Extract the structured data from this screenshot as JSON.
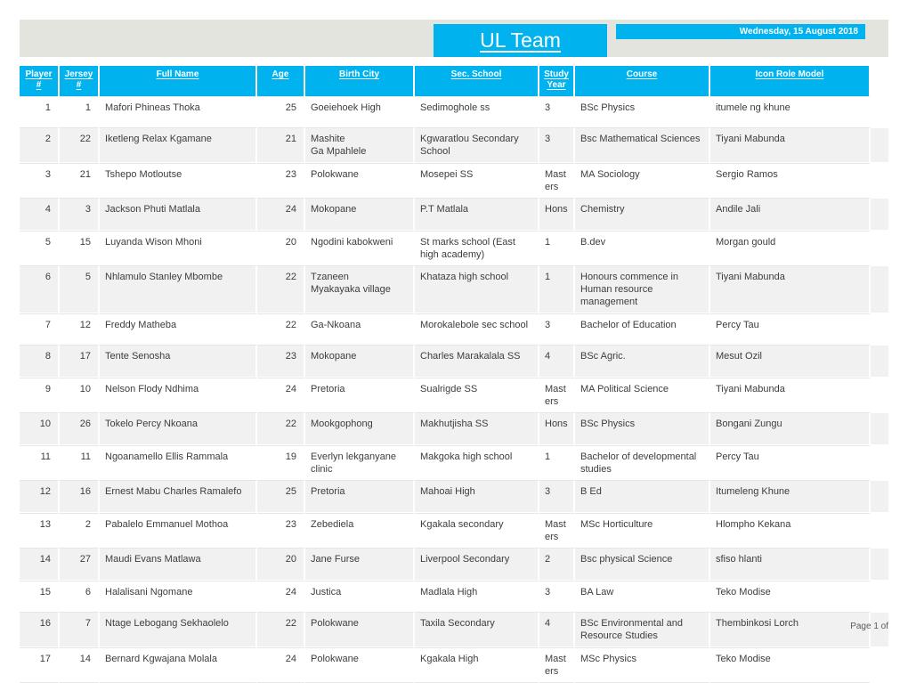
{
  "header": {
    "title": "UL Team",
    "date": "Wednesday, 15 August 2018",
    "band_color": "#e3e4de",
    "accent_color": "#00b3ee"
  },
  "table": {
    "columns": [
      {
        "key": "player",
        "label_line1": "Player",
        "label_line2": "#",
        "align": "num"
      },
      {
        "key": "jersey",
        "label_line1": "Jersey",
        "label_line2": "#",
        "align": "num"
      },
      {
        "key": "name",
        "label_line1": "Full Name",
        "label_line2": "",
        "align": "txt"
      },
      {
        "key": "age",
        "label_line1": "Age",
        "label_line2": "",
        "align": "num"
      },
      {
        "key": "city",
        "label_line1": "Birth City",
        "label_line2": "",
        "align": "txt"
      },
      {
        "key": "school",
        "label_line1": "Sec. School",
        "label_line2": "",
        "align": "txt"
      },
      {
        "key": "year",
        "label_line1": "Study",
        "label_line2": "Year",
        "align": "txt"
      },
      {
        "key": "course",
        "label_line1": "Course",
        "label_line2": "",
        "align": "txt"
      },
      {
        "key": "icon",
        "label_line1": "Icon Role Model",
        "label_line2": "",
        "align": "txt"
      }
    ],
    "rows": [
      {
        "player": "1",
        "jersey": "1",
        "name": "Mafori Phineas Thoka",
        "age": "25",
        "city": "Goeiehoek High",
        "school": "Sedimoghole ss",
        "year": "3",
        "course": "BSc Physics",
        "icon": "itumele ng khune"
      },
      {
        "player": "2",
        "jersey": "22",
        "name": "Iketleng Relax Kgamane",
        "age": "21",
        "city": "Mashite\n Ga Mpahlele",
        "school": "Kgwaratlou Secondary School",
        "year": "3",
        "course": "Bsc Mathematical Sciences",
        "icon": "Tiyani Mabunda"
      },
      {
        "player": "3",
        "jersey": "21",
        "name": "Tshepo Motloutse",
        "age": "23",
        "city": "Polokwane",
        "school": "Mosepei SS",
        "year": "Masters",
        "course": "MA Sociology",
        "icon": "Sergio Ramos"
      },
      {
        "player": "4",
        "jersey": "3",
        "name": "Jackson Phuti Matlala",
        "age": "24",
        "city": "Mokopane",
        "school": "P.T Matlala",
        "year": "Hons",
        "course": "Chemistry",
        "icon": "Andile Jali"
      },
      {
        "player": "5",
        "jersey": "15",
        "name": "Luyanda Wison Mhoni",
        "age": "20",
        "city": "Ngodini kabokweni",
        "school": "St marks school (East high academy)",
        "year": "1",
        "course": "B.dev",
        "icon": "Morgan gould"
      },
      {
        "player": "6",
        "jersey": "5",
        "name": "Nhlamulo Stanley  Mbombe",
        "age": "22",
        "city": "Tzaneen\n Myakayaka village",
        "school": "Khataza high school",
        "year": "1",
        "course": "Honours commence in Human resource management",
        "icon": "Tiyani Mabunda"
      },
      {
        "player": "7",
        "jersey": "12",
        "name": "Freddy  Matheba",
        "age": "22",
        "city": "Ga-Nkoana",
        "school": "Morokalebole sec school",
        "year": "3",
        "course": "Bachelor of Education",
        "icon": "Percy Tau"
      },
      {
        "player": "8",
        "jersey": "17",
        "name": "Tente Senosha",
        "age": "23",
        "city": "Mokopane",
        "school": "Charles Marakalala SS",
        "year": "4",
        "course": "BSc Agric.",
        "icon": "Mesut Ozil"
      },
      {
        "player": "9",
        "jersey": "10",
        "name": "Nelson Flody Ndhima",
        "age": "24",
        "city": "Pretoria",
        "school": "Sualrigde SS",
        "year": "Masters",
        "course": "MA Political Science",
        "icon": "Tiyani Mabunda"
      },
      {
        "player": "10",
        "jersey": "26",
        "name": "Tokelo Percy Nkoana",
        "age": "22",
        "city": "Mookgophong",
        "school": "Makhutjisha SS",
        "year": "Hons",
        "course": "BSc Physics",
        "icon": "Bongani Zungu"
      },
      {
        "player": "11",
        "jersey": "11",
        "name": "Ngoanamello Ellis Rammala",
        "age": "19",
        "city": "Everlyn lekganyane clinic",
        "school": "Makgoka high school",
        "year": "1",
        "course": "Bachelor of developmental studies",
        "icon": "Percy Tau"
      },
      {
        "player": "12",
        "jersey": "16",
        "name": "Ernest Mabu Charles Ramalefo",
        "age": "25",
        "city": "Pretoria",
        "school": "Mahoai High",
        "year": "3",
        "course": "B Ed",
        "icon": "Itumeleng Khune"
      },
      {
        "player": "13",
        "jersey": "2",
        "name": "Pabalelo Emmanuel Mothoa",
        "age": "23",
        "city": "Zebediela",
        "school": "Kgakala secondary",
        "year": "Masters",
        "course": "MSc Horticulture",
        "icon": "Hlompho Kekana"
      },
      {
        "player": "14",
        "jersey": "27",
        "name": "Maudi Evans Matlawa",
        "age": "20",
        "city": "Jane Furse",
        "school": "Liverpool Secondary",
        "year": "2",
        "course": "Bsc physical Science",
        "icon": "sfiso hlanti"
      },
      {
        "player": "15",
        "jersey": "6",
        "name": "Halalisani Ngomane",
        "age": "24",
        "city": "Justica",
        "school": "Madlala High",
        "year": "3",
        "course": "BA Law",
        "icon": "Teko Modise"
      },
      {
        "player": "16",
        "jersey": "7",
        "name": "Ntage Lebogang Sekhaolelo",
        "age": "22",
        "city": "Polokwane",
        "school": "Taxila Secondary",
        "year": "4",
        "course": "BSc Environmental and Resource Studies",
        "icon": "Thembinkosi Lorch"
      },
      {
        "player": "17",
        "jersey": "14",
        "name": "Bernard Kgwajana Molala",
        "age": "24",
        "city": "Polokwane",
        "school": "Kgakala High",
        "year": "Masters",
        "course": "MSc Physics",
        "icon": "Teko Modise"
      }
    ]
  },
  "footer": {
    "page_label": "Page 1 of"
  }
}
